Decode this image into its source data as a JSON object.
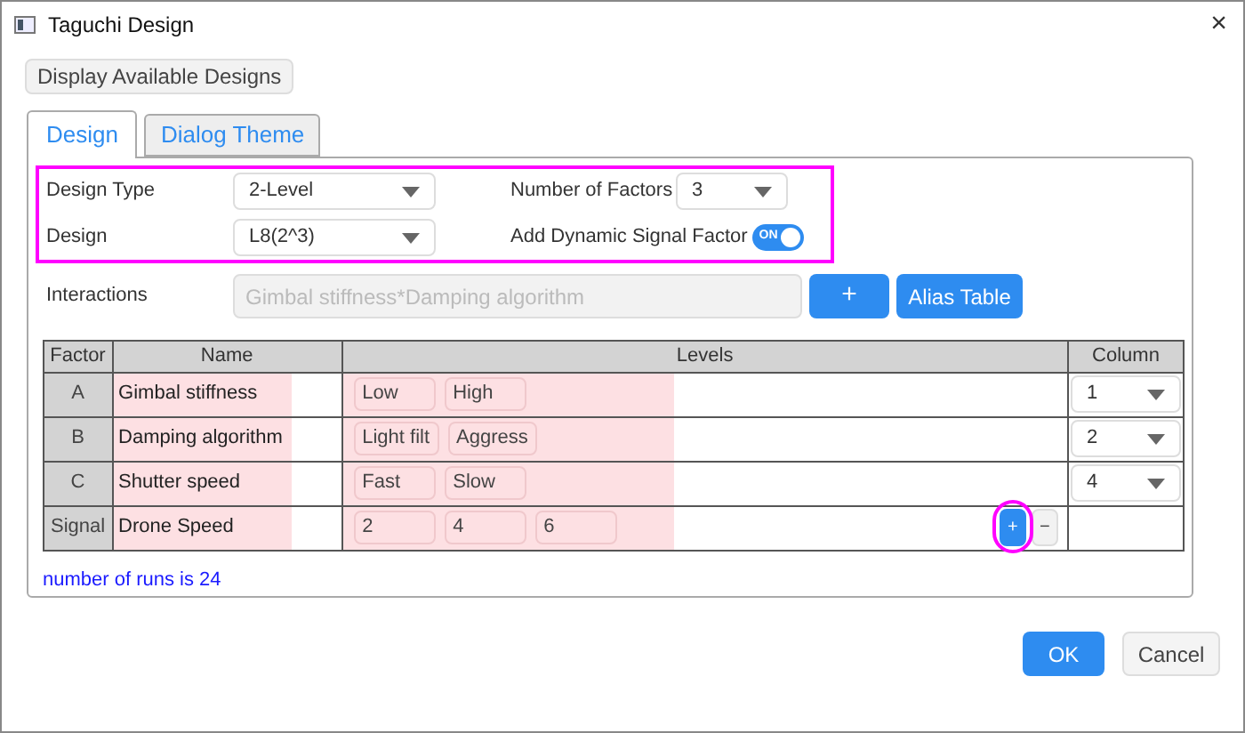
{
  "window": {
    "title": "Taguchi Design",
    "close": "×"
  },
  "display_button": "Display Available Designs",
  "tabs": [
    {
      "label": "Design",
      "selected": true
    },
    {
      "label": "Dialog Theme",
      "selected": false
    }
  ],
  "design_type": {
    "label": "Design Type",
    "value": "2-Level"
  },
  "number_of_factors": {
    "label": "Number of Factors",
    "value": "3"
  },
  "design": {
    "label": "Design",
    "value": "L8(2^3)"
  },
  "dynamic_signal": {
    "label": "Add Dynamic Signal Factor",
    "on": true,
    "text": "ON"
  },
  "interactions": {
    "label": "Interactions",
    "placeholder": "Gimbal stiffness*Damping algorithm",
    "add": "+",
    "alias": "Alias Table"
  },
  "table": {
    "columns": [
      "Factor",
      "Name",
      "Levels",
      "Column"
    ],
    "rows": [
      {
        "kind": "factor",
        "factor": "A",
        "name": "Gimbal stiffness",
        "levels": [
          "Low",
          "High"
        ],
        "column": "1"
      },
      {
        "kind": "factor",
        "factor": "B",
        "name": "Damping algorithm",
        "levels": [
          "Light filt",
          "Aggress"
        ],
        "column": "2"
      },
      {
        "kind": "factor",
        "factor": "C",
        "name": "Shutter speed",
        "levels": [
          "Fast",
          "Slow"
        ],
        "column": "4"
      },
      {
        "kind": "signal",
        "factor": "Signal",
        "name": "Drone Speed",
        "levels": [
          "2",
          "4",
          "6"
        ],
        "add": "+",
        "remove": "−"
      }
    ]
  },
  "runs_note": "number of runs is 24",
  "footer": {
    "ok": "OK",
    "cancel": "Cancel"
  }
}
